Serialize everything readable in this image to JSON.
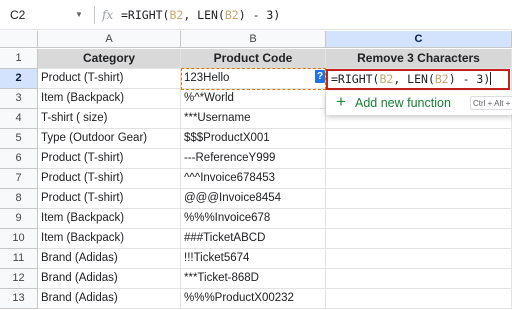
{
  "formula_bar": {
    "cell_ref": "C2",
    "caret_glyph": "▼",
    "fx_label": "fx",
    "formula_parts": [
      "=RIGHT(",
      "B2",
      ", LEN(",
      "B2",
      ") - 3)"
    ]
  },
  "columns": [
    {
      "letter": "A",
      "selected": false
    },
    {
      "letter": "B",
      "selected": false
    },
    {
      "letter": "C",
      "selected": true
    }
  ],
  "row_numbers": [
    "1",
    "2",
    "3",
    "4",
    "5",
    "6",
    "7",
    "8",
    "9",
    "10",
    "11",
    "12",
    "13"
  ],
  "header_row": {
    "category": "Category",
    "product_code": "Product Code",
    "remove": "Remove 3 Characters"
  },
  "rows": [
    {
      "category": "Product (T-shirt)",
      "code": "123Hello"
    },
    {
      "category": "Item (Backpack)",
      "code": "%^*World"
    },
    {
      "category": "T-shirt ( size)",
      "code": "***Username"
    },
    {
      "category": "Type (Outdoor Gear)",
      "code": "$$$ProductX001"
    },
    {
      "category": "Product (T-shirt)",
      "code": "---ReferenceY999"
    },
    {
      "category": "Product (T-shirt)",
      "code": "^^^Invoice678453"
    },
    {
      "category": "Product (T-shirt)",
      "code": "@@@Invoice8454"
    },
    {
      "category": "Item (Backpack)",
      "code": "%%%Invoice678"
    },
    {
      "category": "Item (Backpack)",
      "code": "###TicketABCD"
    },
    {
      "category": "Brand (Adidas)",
      "code": "!!!Ticket5674"
    },
    {
      "category": "Brand (Adidas)",
      "code": "***Ticket-868D"
    },
    {
      "category": "Brand (Adidas)",
      "code": "%%%ProductX00232"
    }
  ],
  "editor": {
    "formula_parts": [
      "=RIGHT(",
      "B2",
      ", LEN(",
      "B2",
      ") - 3)"
    ],
    "help_chip": "?"
  },
  "autocomplete": {
    "plus_glyph": "+",
    "label": "Add new function",
    "shortcut": "Ctrl + Alt + ="
  },
  "colors": {
    "selection_header": "#d3e3fd",
    "editor_border": "#c5221f",
    "copy_border": "#e37400",
    "reference_text": "#c5a572",
    "add_function_green": "#188038"
  }
}
